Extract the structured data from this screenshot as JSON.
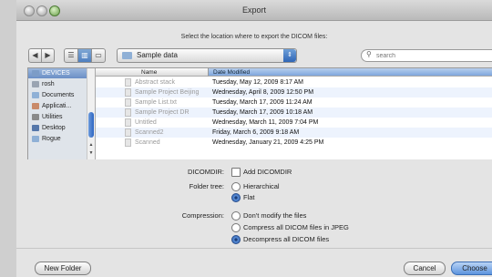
{
  "window": {
    "title": "Export"
  },
  "dialog": {
    "prompt": "Select the location where to export the DICOM files:"
  },
  "toolbar": {
    "back": "◀",
    "forward": "▶",
    "views": [
      "list-view-icon",
      "column-view-icon",
      "coverflow-icon"
    ],
    "location": "Sample data",
    "search_placeholder": "search"
  },
  "sidebar": {
    "items": [
      {
        "label": "DEVICES",
        "icon": "disk-icon",
        "selected": true
      },
      {
        "label": "rosh",
        "icon": "home-icon"
      },
      {
        "label": "Documents",
        "icon": "folder-icon"
      },
      {
        "label": "Applicati...",
        "icon": "applications-icon"
      },
      {
        "label": "Utilities",
        "icon": "tools-icon"
      },
      {
        "label": "Desktop",
        "icon": "desktop-icon"
      },
      {
        "label": "Rogue",
        "icon": "folder-icon"
      }
    ]
  },
  "files": {
    "columns": [
      "Name",
      "Date Modified"
    ],
    "rows": [
      {
        "name": "Abstract stack",
        "date": "Tuesday, May 12, 2009 8:17 AM"
      },
      {
        "name": "Sample Project Beijing",
        "date": "Wednesday, April 8, 2009 12:50 PM"
      },
      {
        "name": "Sample List.txt",
        "date": "Tuesday, March 17, 2009 11:24 AM"
      },
      {
        "name": "Sample Project DR",
        "date": "Tuesday, March 17, 2009 10:18 AM"
      },
      {
        "name": "Untitled",
        "date": "Wednesday, March 11, 2009 7:04 PM"
      },
      {
        "name": "Scanned2",
        "date": "Friday, March 6, 2009 9:18 AM"
      },
      {
        "name": "Scanned",
        "date": "Wednesday, January 21, 2009 4:25 PM"
      }
    ]
  },
  "options": {
    "dicomdir_label": "DICOMDIR:",
    "dicomdir_checkbox": "Add DICOMDIR",
    "dicomdir_checked": false,
    "folder_tree_label": "Folder tree:",
    "folder_tree_options": [
      "Hierarchical",
      "Flat"
    ],
    "folder_tree_selected": 1,
    "compression_label": "Compression:",
    "compression_options": [
      "Don't modify the files",
      "Compress all DICOM files in JPEG",
      "Decompress all DICOM files"
    ],
    "compression_selected": 2
  },
  "buttons": {
    "new_folder": "New Folder",
    "cancel": "Cancel",
    "choose": "Choose"
  },
  "colors": {
    "accent": "#5c94de",
    "selection": "#7ea6dc"
  }
}
